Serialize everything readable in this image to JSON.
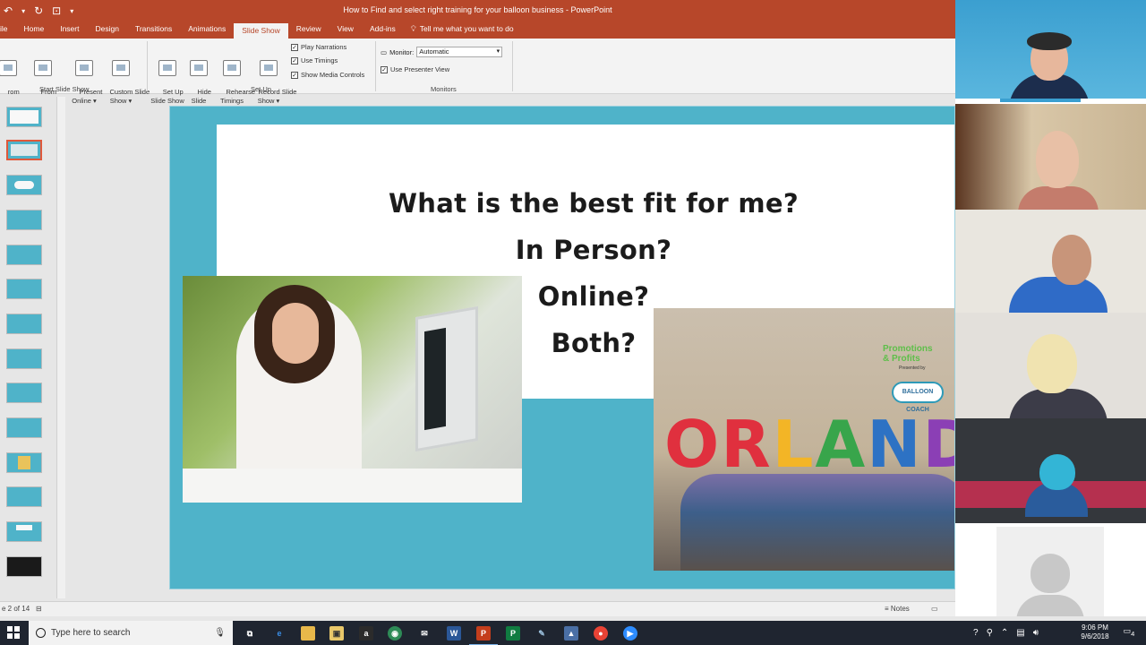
{
  "window": {
    "title": "How to Find and select right training for your balloon business  -  PowerPoint"
  },
  "ribbon": {
    "tabs": [
      "ile",
      "Home",
      "Insert",
      "Design",
      "Transitions",
      "Animations",
      "Slide Show",
      "Review",
      "View",
      "Add-ins"
    ],
    "active_tab": "Slide Show",
    "tell_me": "Tell me what you want to do",
    "start_group": {
      "label": "Start Slide Show",
      "from_beginning": "rom\ninning",
      "from_current": "From\nCurrent Slide",
      "present_online": "Present\nOnline ▾",
      "custom_show": "Custom Slide\nShow ▾"
    },
    "setup_group": {
      "label": "Set Up",
      "set_up_show": "Set Up\nSlide Show",
      "hide_slide": "Hide\nSlide",
      "rehearse": "Rehearse\nTimings",
      "record": "Record Slide\nShow ▾",
      "play_narrations": "Play Narrations",
      "use_timings": "Use Timings",
      "show_media_controls": "Show Media Controls"
    },
    "monitors_group": {
      "label": "Monitors",
      "monitor_label": "Monitor:",
      "monitor_value": "Automatic",
      "use_presenter_view": "Use Presenter View"
    }
  },
  "slide": {
    "lines": [
      "What is the best fit for me?",
      "In Person?",
      "Online?",
      "Both?"
    ],
    "photo2_logo": "Promotions\n& Profits",
    "photo2_presented": "Presented by",
    "photo2_coach": "BALLOON COACH",
    "photo2_balloons": "ORLANDO"
  },
  "status": {
    "slide_indicator": "e 2 of 14",
    "notes": "Notes"
  },
  "taskbar": {
    "search_placeholder": "Type here to search",
    "time": "9:06 PM",
    "date": "9/6/2018",
    "notification_count": "4"
  },
  "colors": {
    "ppt_accent": "#b7472a",
    "slide_teal": "#4fb3c9"
  }
}
